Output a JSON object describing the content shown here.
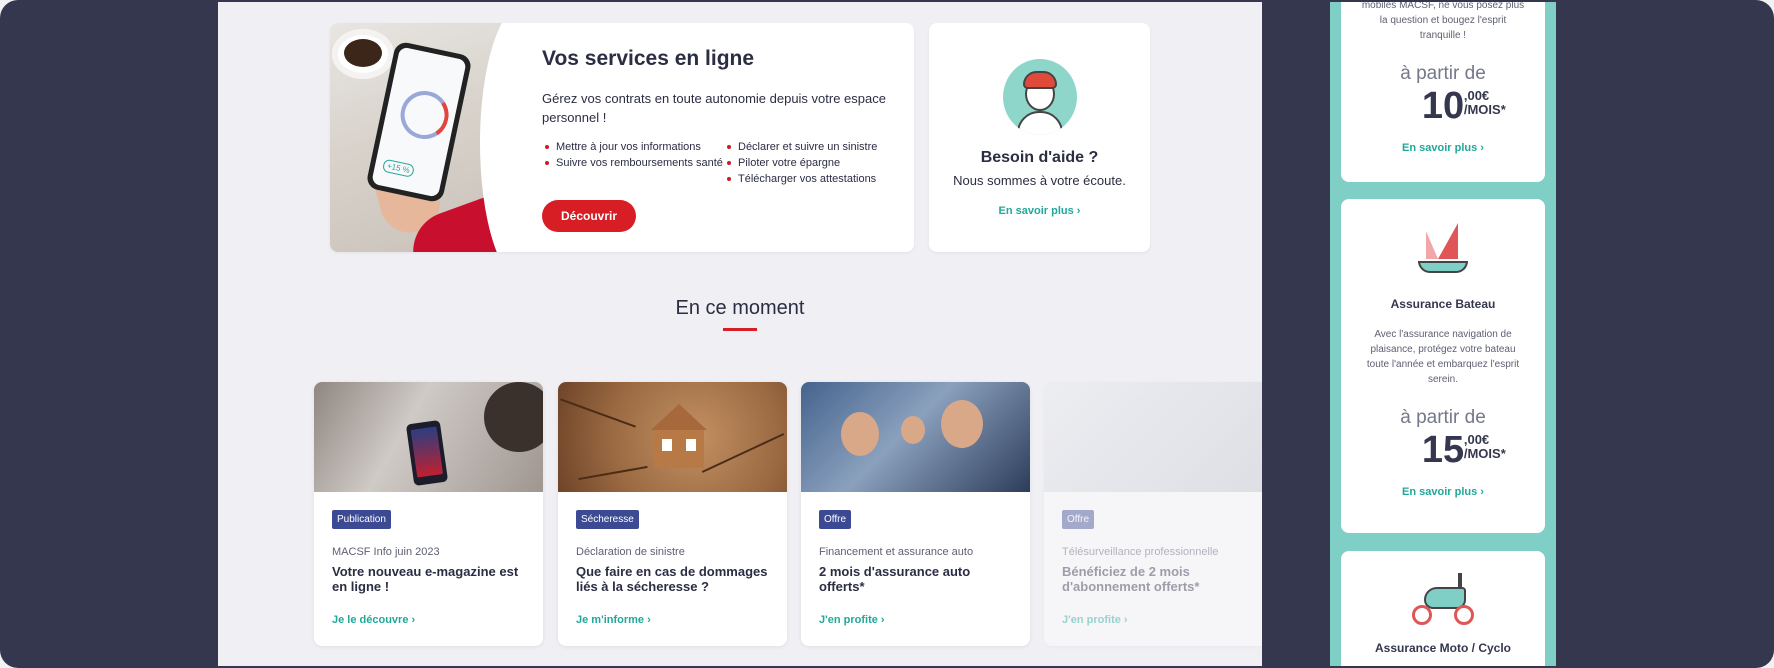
{
  "services": {
    "title": "Vos services en ligne",
    "description": "Gérez vos contrats en toute autonomie depuis votre espace personnel !",
    "list_left": [
      "Mettre à jour vos informations",
      "Suivre vos remboursements santé"
    ],
    "list_right": [
      "Déclarer et suivre un sinistre",
      "Piloter votre épargne",
      "Télécharger vos attestations"
    ],
    "button": "Découvrir"
  },
  "help": {
    "title": "Besoin d'aide ?",
    "text": "Nous sommes à votre écoute.",
    "link": "En savoir plus ›"
  },
  "section": {
    "title": "En ce moment"
  },
  "news": [
    {
      "badge": "Publication",
      "category": "MACSF Info juin 2023",
      "title": "Votre nouveau e-magazine est en ligne !",
      "link": "Je le découvre ›"
    },
    {
      "badge": "Sécheresse",
      "category": "Déclaration de sinistre",
      "title": "Que faire en cas de dommages liés à la sécheresse ?",
      "link": "Je m'informe ›"
    },
    {
      "badge": "Offre",
      "category": "Financement et assurance auto",
      "title": "2 mois d'assurance auto offerts*",
      "link": "J'en profite ›"
    },
    {
      "badge": "Offre",
      "category": "Télésurveillance professionnelle",
      "title": "Bénéficiez de 2 mois d'abonnement offerts*",
      "link": "J'en profite ›"
    }
  ],
  "side": {
    "top_text": "mobiles MACSF, ne vous posez plus la question et bougez l'esprit tranquille !",
    "top_from": "à partir de",
    "top_price": "10",
    "top_cents": ",00€",
    "top_per": "/MOIS*",
    "top_link": "En savoir plus ›",
    "boat_title": "Assurance Bateau",
    "boat_desc": "Avec l'assurance navigation de plaisance, protégez votre bateau toute l'année et embarquez l'esprit serein.",
    "boat_from": "à partir de",
    "boat_price": "15",
    "boat_cents": ",00€",
    "boat_per": "/MOIS*",
    "boat_link": "En savoir plus ›",
    "moto_title": "Assurance Moto / Cyclo"
  },
  "colors": {
    "brand_red": "#d81e25",
    "teal": "#22a89a",
    "badge_blue": "#3b4a93",
    "frame": "#35374f"
  },
  "icons": [
    "smartphone-photo",
    "support-avatar-icon",
    "boat-icon",
    "scooter-icon"
  ]
}
